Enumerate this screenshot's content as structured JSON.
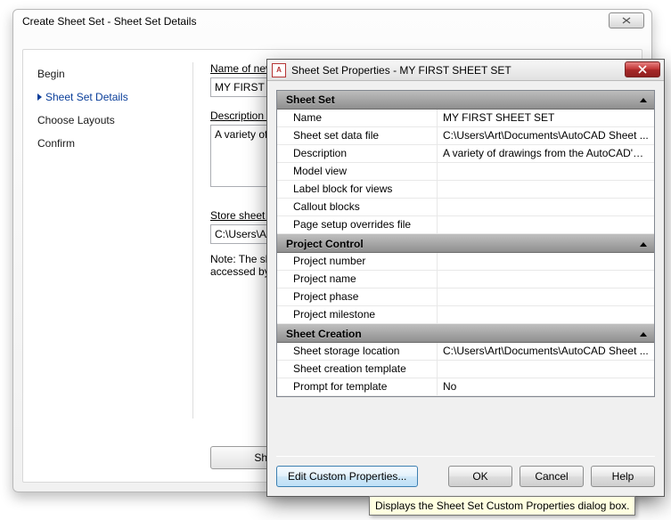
{
  "wizard": {
    "title": "Create Sheet Set - Sheet Set Details",
    "steps": {
      "begin": "Begin",
      "details": "Sheet Set Details",
      "layouts": "Choose Layouts",
      "confirm": "Confirm"
    },
    "name_label": "Name of new",
    "name_value": "MY FIRST S",
    "description_label": "Description (",
    "description_value": "A variety of d",
    "store_label": "Store sheet s",
    "store_value": "C:\\Users\\Ar",
    "note": "Note: The sh\naccessed by",
    "props_button": "She"
  },
  "props": {
    "title": "Sheet Set Properties - MY FIRST SHEET SET",
    "app_icon_text": "A",
    "sections": {
      "sheet_set": {
        "header": "Sheet Set",
        "rows": {
          "name_k": "Name",
          "name_v": "MY FIRST SHEET SET",
          "data_k": "Sheet set data file",
          "data_v": "C:\\Users\\Art\\Documents\\AutoCAD Sheet ...",
          "desc_k": "Description",
          "desc_v": "A variety of drawings from the AutoCAD's ...",
          "model_k": "Model view",
          "model_v": "",
          "label_k": "Label block for views",
          "label_v": "",
          "callout_k": "Callout blocks",
          "callout_v": "",
          "pso_k": "Page setup overrides file",
          "pso_v": ""
        }
      },
      "project_control": {
        "header": "Project Control",
        "rows": {
          "pnum_k": "Project number",
          "pnum_v": "",
          "pname_k": "Project name",
          "pname_v": "",
          "pphase_k": "Project phase",
          "pphase_v": "",
          "pmile_k": "Project milestone",
          "pmile_v": ""
        }
      },
      "sheet_creation": {
        "header": "Sheet Creation",
        "rows": {
          "loc_k": "Sheet storage location",
          "loc_v": "C:\\Users\\Art\\Documents\\AutoCAD Sheet ...",
          "tmpl_k": "Sheet creation template",
          "tmpl_v": "",
          "prompt_k": "Prompt for template",
          "prompt_v": "No"
        }
      }
    },
    "buttons": {
      "edit": "Edit Custom Properties...",
      "ok": "OK",
      "cancel": "Cancel",
      "help": "Help"
    }
  },
  "tooltip": "Displays the Sheet Set Custom Properties dialog box."
}
